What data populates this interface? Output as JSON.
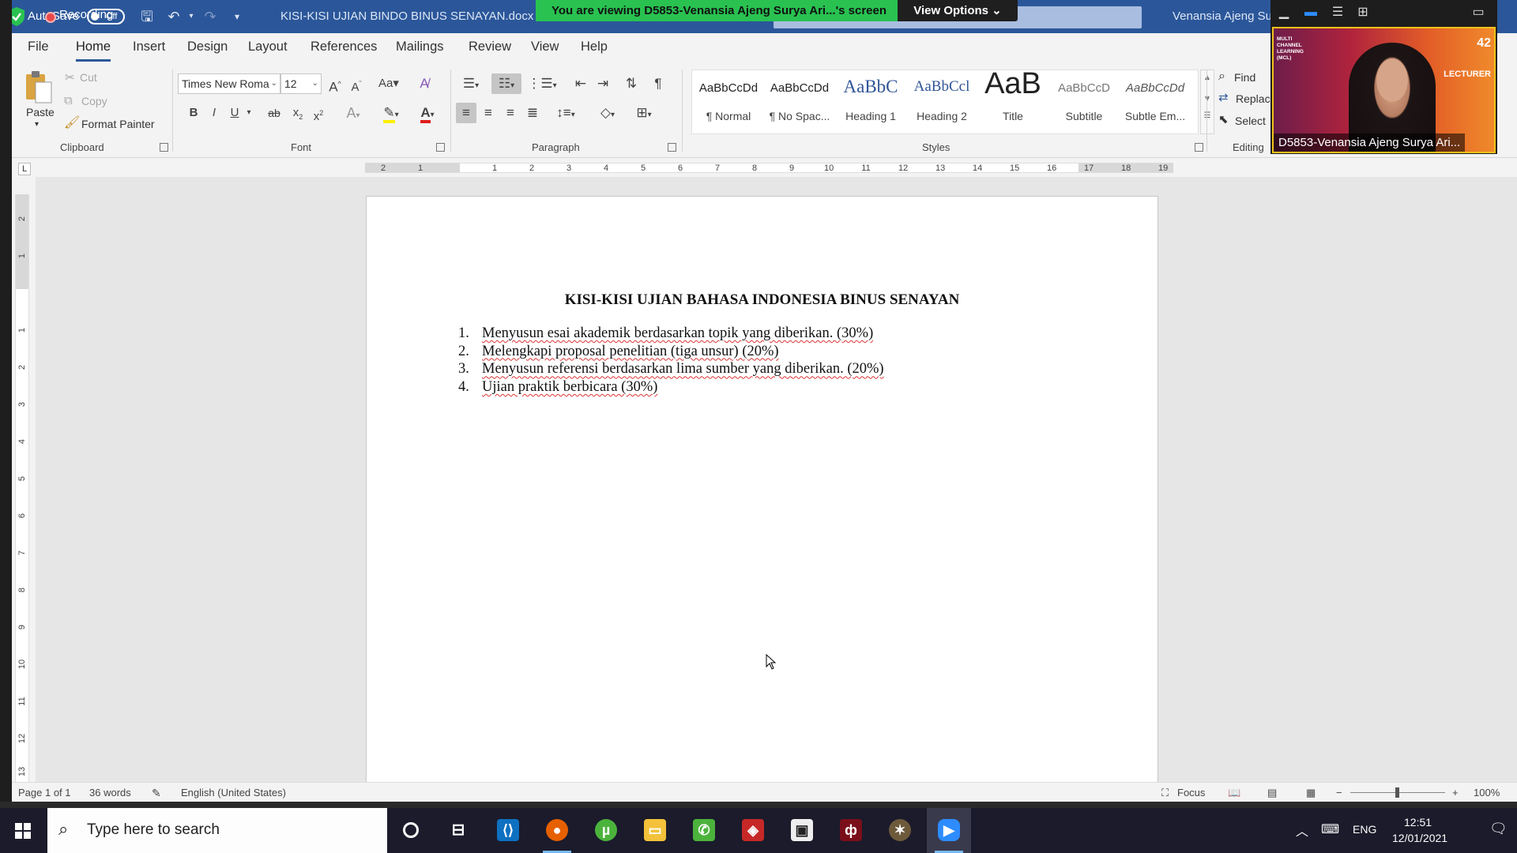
{
  "word": {
    "title_bar": {
      "autosave_label": "AutoSave",
      "autosave_state": "Off",
      "document_title": "KISI-KISI UJIAN BINDO BINUS SENAYAN.docx  -  C",
      "user_name": "Venansia Ajeng Su"
    },
    "menu_tabs": [
      "File",
      "Home",
      "Insert",
      "Design",
      "Layout",
      "References",
      "Mailings",
      "Review",
      "View",
      "Help"
    ],
    "active_tab": "Home",
    "clipboard": {
      "paste": "Paste",
      "cut": "Cut",
      "copy": "Copy",
      "format_painter": "Format Painter",
      "group_label": "Clipboard"
    },
    "font": {
      "font_name": "Times New Roma",
      "font_size": "12",
      "bold": "B",
      "italic": "I",
      "underline": "U",
      "strikethrough": "ab",
      "subscript": "x",
      "superscript": "x",
      "change_case": "Aa",
      "group_label": "Font"
    },
    "paragraph": {
      "group_label": "Paragraph"
    },
    "styles": {
      "items": [
        {
          "sample": "AaBbCcDd",
          "name": "¶ Normal"
        },
        {
          "sample": "AaBbCcDd",
          "name": "¶ No Spac..."
        },
        {
          "sample": "AaBbC",
          "name": "Heading 1"
        },
        {
          "sample": "AaBbCcl",
          "name": "Heading 2"
        },
        {
          "sample": "AaB",
          "name": "Title"
        },
        {
          "sample": "AaBbCcD",
          "name": "Subtitle"
        },
        {
          "sample": "AaBbCcDd",
          "name": "Subtle Em..."
        }
      ],
      "group_label": "Styles"
    },
    "editing": {
      "find": "Find",
      "replace": "Replac",
      "select": "Select",
      "group_label": "Editing"
    },
    "ruler": {
      "tab_selector": "L",
      "h_ticks": [
        "2",
        "1",
        "1",
        "2",
        "3",
        "4",
        "5",
        "6",
        "7",
        "8",
        "9",
        "10",
        "11",
        "12",
        "13",
        "14",
        "15",
        "16",
        "17",
        "18",
        "19"
      ],
      "v_ticks": [
        "2",
        "1",
        "1",
        "2",
        "3",
        "4",
        "5",
        "6",
        "7",
        "8",
        "9",
        "10",
        "11",
        "12",
        "13"
      ]
    },
    "document": {
      "title": "KISI-KISI UJIAN BAHASA INDONESIA BINUS SENAYAN",
      "list": [
        {
          "num": "1.",
          "text": "Menyusun esai akademik berdasarkan topik yang diberikan. (30%)"
        },
        {
          "num": "2.",
          "text": "Melengkapi proposal penelitian (tiga unsur) (20%)"
        },
        {
          "num": "3.",
          "text": "Menyusun referensi berdasarkan lima sumber yang diberikan. (20%)"
        },
        {
          "num": "4.",
          "text": "Ujian praktik berbicara (30%)"
        }
      ]
    },
    "status_bar": {
      "page": "Page 1 of 1",
      "words": "36 words",
      "language": "English (United States)",
      "focus": "Focus",
      "zoom": "100%"
    }
  },
  "zoom": {
    "recording_label": "Recording",
    "share_banner": "You are viewing D5853-Venansia Ajeng Surya Ari...'s screen",
    "view_options": "View Options",
    "participant_name": "D5853-Venansia Ajeng Surya Ari...",
    "video_logo_text": "MULTI CHANNEL LEARNING (MCL)",
    "video_lecturer": "LECTURER",
    "video_year": "42"
  },
  "taskbar": {
    "search_placeholder": "Type here to search",
    "language": "ENG",
    "time": "12:51",
    "date": "12/01/2021"
  },
  "colors": {
    "word_blue": "#2b579a",
    "zoom_green": "#29c251"
  }
}
